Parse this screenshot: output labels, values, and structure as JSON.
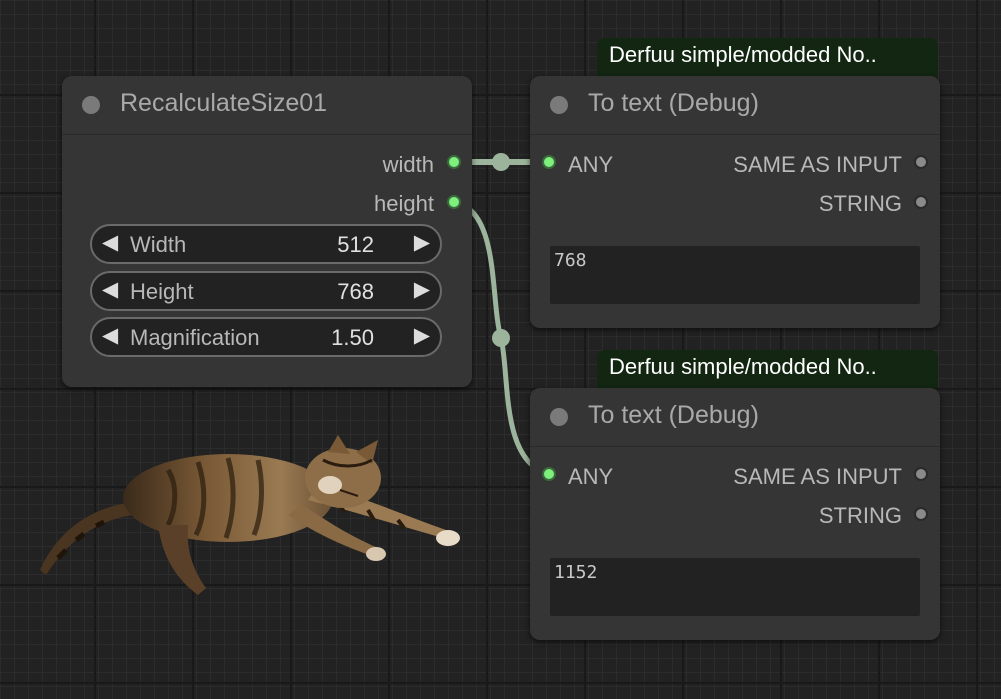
{
  "canvas": {
    "grid_color": "#191919",
    "background": "#222222"
  },
  "colors": {
    "node_bg": "#353535",
    "slot_connected": "#7ef07e",
    "slot_unconnected": "#8a8a8a",
    "wire": "#9cb39c",
    "group_bg": "#122612"
  },
  "recalc_node": {
    "title": "RecalculateSize01",
    "status_icon": "status-dot-icon",
    "outputs": [
      {
        "label": "width"
      },
      {
        "label": "height"
      }
    ],
    "widgets": [
      {
        "label": "Width",
        "value": "512"
      },
      {
        "label": "Height",
        "value": "768"
      },
      {
        "label": "Magnification",
        "value": "1.50"
      }
    ],
    "arrow_left": "◀",
    "arrow_right": "▶"
  },
  "debug_nodes": [
    {
      "group_label": "Derfuu simple/modded No..",
      "title": "To text (Debug)",
      "input_label": "ANY",
      "outputs": [
        {
          "label": "SAME AS INPUT"
        },
        {
          "label": "STRING"
        }
      ],
      "text_value": "768"
    },
    {
      "group_label": "Derfuu simple/modded No..",
      "title": "To text (Debug)",
      "input_label": "ANY",
      "outputs": [
        {
          "label": "SAME AS INPUT"
        },
        {
          "label": "STRING"
        }
      ],
      "text_value": "1152"
    }
  ],
  "image": {
    "subject": "cat-image",
    "description": "tabby cat leaping"
  }
}
